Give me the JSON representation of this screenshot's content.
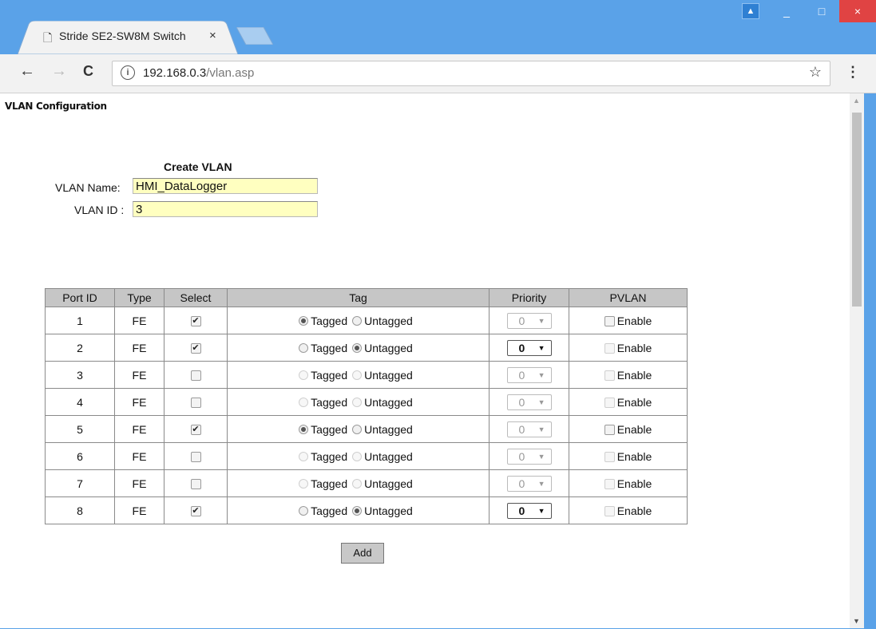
{
  "browser": {
    "tab_title": "Stride SE2-SW8M Switch",
    "tab_close": "×",
    "url_host": "192.168.0.3",
    "url_path": "/vlan.asp",
    "info_glyph": "i",
    "back_glyph": "←",
    "forward_glyph": "→",
    "reload_glyph": "C",
    "star_glyph": "☆",
    "menu_glyph": "⋮",
    "min_glyph": "_",
    "max_glyph": "□",
    "close_glyph": "×",
    "user_glyph": "▲"
  },
  "page": {
    "title": "VLAN Configuration",
    "create_title": "Create VLAN",
    "vlan_name_label": "VLAN Name:",
    "vlan_name_value": "HMI_DataLogger",
    "vlan_id_label": "VLAN ID :",
    "vlan_id_value": "3",
    "add_button": "Add"
  },
  "table": {
    "headers": [
      "Port ID",
      "Type",
      "Select",
      "Tag",
      "Priority",
      "PVLAN"
    ],
    "tagged_label": "Tagged",
    "untagged_label": "Untagged",
    "enable_label": "Enable",
    "rows": [
      {
        "port": "1",
        "type": "FE",
        "selected": true,
        "tag": "tagged",
        "priority": "0",
        "priority_enabled": false,
        "pvlan_enabled": true,
        "pvlan_checked": false
      },
      {
        "port": "2",
        "type": "FE",
        "selected": true,
        "tag": "untagged",
        "priority": "0",
        "priority_enabled": true,
        "pvlan_enabled": false,
        "pvlan_checked": false
      },
      {
        "port": "3",
        "type": "FE",
        "selected": false,
        "tag": "none",
        "priority": "0",
        "priority_enabled": false,
        "pvlan_enabled": false,
        "pvlan_checked": false
      },
      {
        "port": "4",
        "type": "FE",
        "selected": false,
        "tag": "none",
        "priority": "0",
        "priority_enabled": false,
        "pvlan_enabled": false,
        "pvlan_checked": false
      },
      {
        "port": "5",
        "type": "FE",
        "selected": true,
        "tag": "tagged",
        "priority": "0",
        "priority_enabled": false,
        "pvlan_enabled": true,
        "pvlan_checked": false
      },
      {
        "port": "6",
        "type": "FE",
        "selected": false,
        "tag": "none",
        "priority": "0",
        "priority_enabled": false,
        "pvlan_enabled": false,
        "pvlan_checked": false
      },
      {
        "port": "7",
        "type": "FE",
        "selected": false,
        "tag": "none",
        "priority": "0",
        "priority_enabled": false,
        "pvlan_enabled": false,
        "pvlan_checked": false
      },
      {
        "port": "8",
        "type": "FE",
        "selected": true,
        "tag": "untagged",
        "priority": "0",
        "priority_enabled": true,
        "pvlan_enabled": false,
        "pvlan_checked": false
      }
    ]
  },
  "colors": {
    "window_frame": "#5aa2e8",
    "input_bg": "#ffffc0",
    "header_bg": "#c6c6c6",
    "close_button": "#e04343"
  }
}
